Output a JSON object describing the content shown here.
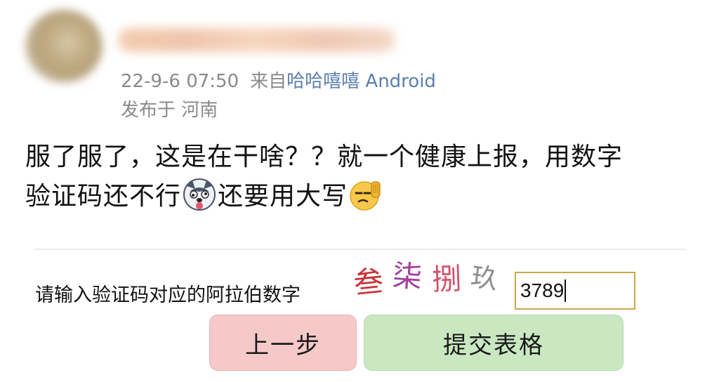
{
  "post": {
    "timestamp": "22-9-6 07:50",
    "source_prefix": "来自",
    "client": "哈哈嘻嘻 Android",
    "location": "发布于 河南",
    "text_line1": "服了服了，这是在干啥？？就一个健康上报，用数字",
    "text_line2_a": "验证码还不行",
    "text_line2_b": "还要用大写"
  },
  "form": {
    "prompt": "请输入验证码对应的阿拉伯数字",
    "captcha": [
      "叁",
      "柒",
      "捌",
      "玖"
    ],
    "answer_value": "3789",
    "prev_button": "上一步",
    "submit_button": "提交表格"
  },
  "colors": {
    "client_link": "#5b7fb0",
    "meta_text": "#8a8a8a",
    "prev_button_bg": "#f6c9c9",
    "submit_button_bg": "#c9e8c2",
    "input_border": "#c9a84a"
  },
  "icons": [
    "husky-emoji",
    "salute-face-emoji"
  ]
}
